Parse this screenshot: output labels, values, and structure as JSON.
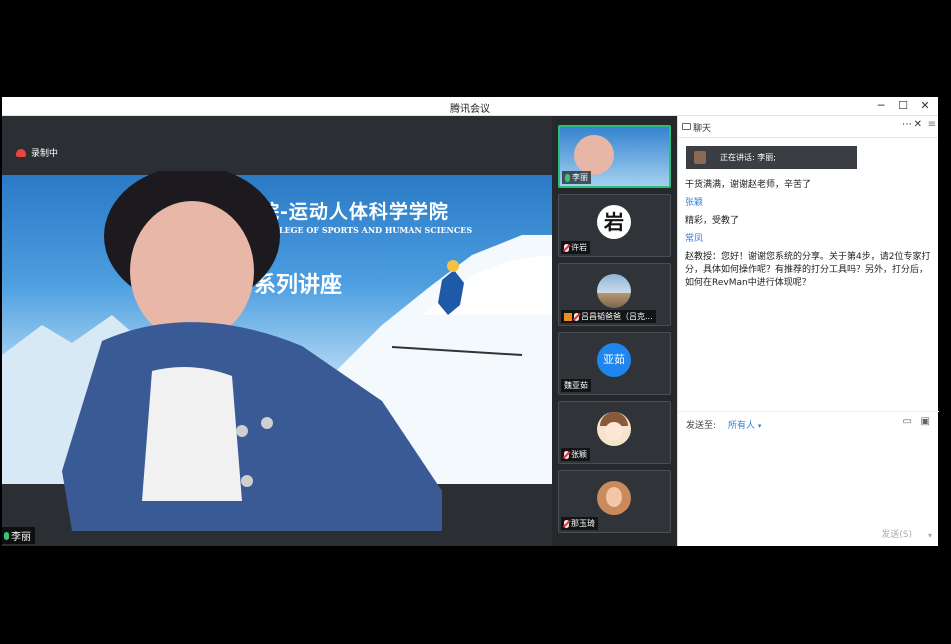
{
  "window": {
    "title": "腾讯会议",
    "controls": [
      "minimize-icon",
      "maximize-icon",
      "close-icon"
    ]
  },
  "recording": {
    "label": "录制中"
  },
  "slide": {
    "title": "院-运动人体科学学院",
    "subtitle": "COLLEGE OF SPORTS AND HUMAN SCIENCES",
    "series": "系列讲座"
  },
  "main_speaker": {
    "name": "李丽"
  },
  "participants": [
    {
      "name": "李丽",
      "mic": "on"
    },
    {
      "name": "许岩",
      "mic": "off",
      "avatar_text": "岩"
    },
    {
      "name": "吕昌韬爸爸（吕克...",
      "mic": "off"
    },
    {
      "name": "魏亚茹",
      "mic": "none",
      "avatar_text": "亚茹"
    },
    {
      "name": "张颖",
      "mic": "off"
    },
    {
      "name": "那玉琦",
      "mic": "off"
    }
  ],
  "chat": {
    "title": "聊天",
    "speaking_label": "正在讲话: 李丽;",
    "messages": [
      {
        "name": "",
        "text": "干货满满，谢谢赵老师，辛苦了"
      },
      {
        "name": "张颖",
        "text": "精彩，受教了"
      },
      {
        "name": "常凤",
        "text": "赵教授：您好！谢谢您系统的分享。关于第4步，请2位专家打分，具体如何操作呢？有推荐的打分工具吗？另外，打分后，如何在RevMan中进行体现呢？"
      }
    ],
    "send_to_label": "发送至:",
    "recipient": "所有人",
    "send_button": "发送(S)"
  },
  "colors": {
    "accent": "#2d7bd8",
    "active_border": "#2dbf7a",
    "rec": "#e9463f"
  }
}
